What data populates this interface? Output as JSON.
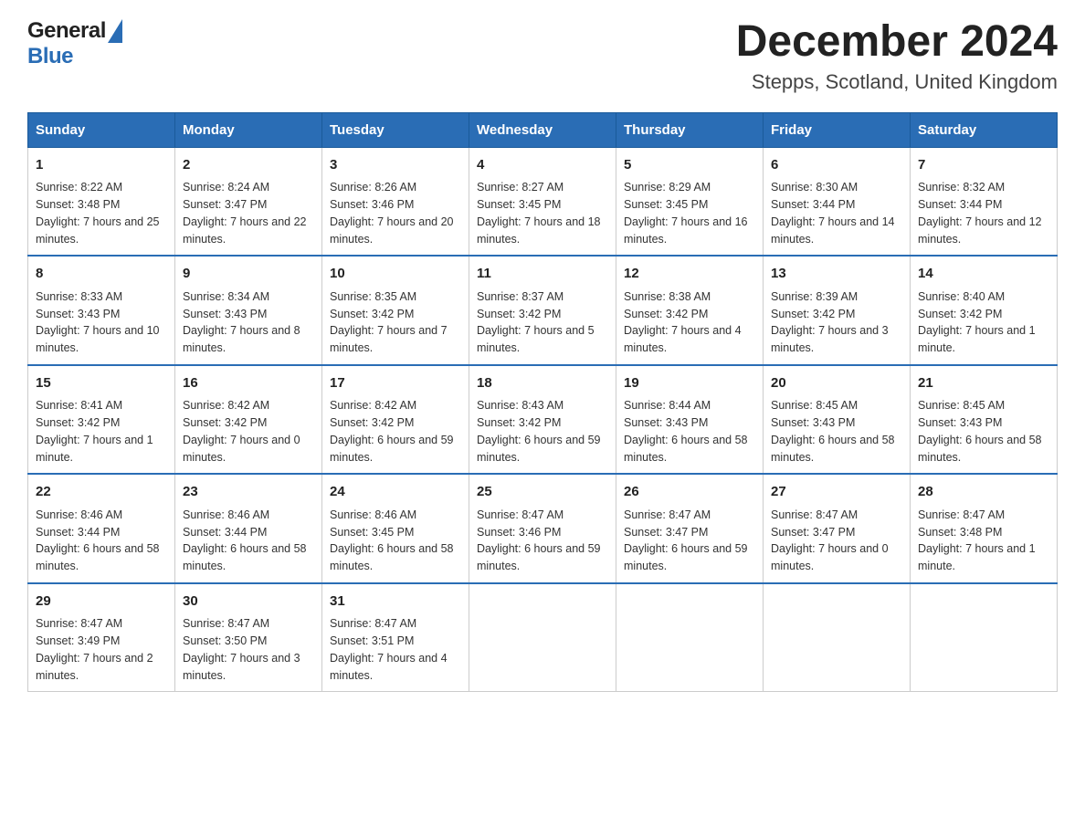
{
  "header": {
    "title": "December 2024",
    "subtitle": "Stepps, Scotland, United Kingdom",
    "logo_general": "General",
    "logo_blue": "Blue"
  },
  "calendar": {
    "days_of_week": [
      "Sunday",
      "Monday",
      "Tuesday",
      "Wednesday",
      "Thursday",
      "Friday",
      "Saturday"
    ],
    "weeks": [
      [
        {
          "day": "1",
          "sunrise": "8:22 AM",
          "sunset": "3:48 PM",
          "daylight": "7 hours and 25 minutes."
        },
        {
          "day": "2",
          "sunrise": "8:24 AM",
          "sunset": "3:47 PM",
          "daylight": "7 hours and 22 minutes."
        },
        {
          "day": "3",
          "sunrise": "8:26 AM",
          "sunset": "3:46 PM",
          "daylight": "7 hours and 20 minutes."
        },
        {
          "day": "4",
          "sunrise": "8:27 AM",
          "sunset": "3:45 PM",
          "daylight": "7 hours and 18 minutes."
        },
        {
          "day": "5",
          "sunrise": "8:29 AM",
          "sunset": "3:45 PM",
          "daylight": "7 hours and 16 minutes."
        },
        {
          "day": "6",
          "sunrise": "8:30 AM",
          "sunset": "3:44 PM",
          "daylight": "7 hours and 14 minutes."
        },
        {
          "day": "7",
          "sunrise": "8:32 AM",
          "sunset": "3:44 PM",
          "daylight": "7 hours and 12 minutes."
        }
      ],
      [
        {
          "day": "8",
          "sunrise": "8:33 AM",
          "sunset": "3:43 PM",
          "daylight": "7 hours and 10 minutes."
        },
        {
          "day": "9",
          "sunrise": "8:34 AM",
          "sunset": "3:43 PM",
          "daylight": "7 hours and 8 minutes."
        },
        {
          "day": "10",
          "sunrise": "8:35 AM",
          "sunset": "3:42 PM",
          "daylight": "7 hours and 7 minutes."
        },
        {
          "day": "11",
          "sunrise": "8:37 AM",
          "sunset": "3:42 PM",
          "daylight": "7 hours and 5 minutes."
        },
        {
          "day": "12",
          "sunrise": "8:38 AM",
          "sunset": "3:42 PM",
          "daylight": "7 hours and 4 minutes."
        },
        {
          "day": "13",
          "sunrise": "8:39 AM",
          "sunset": "3:42 PM",
          "daylight": "7 hours and 3 minutes."
        },
        {
          "day": "14",
          "sunrise": "8:40 AM",
          "sunset": "3:42 PM",
          "daylight": "7 hours and 1 minute."
        }
      ],
      [
        {
          "day": "15",
          "sunrise": "8:41 AM",
          "sunset": "3:42 PM",
          "daylight": "7 hours and 1 minute."
        },
        {
          "day": "16",
          "sunrise": "8:42 AM",
          "sunset": "3:42 PM",
          "daylight": "7 hours and 0 minutes."
        },
        {
          "day": "17",
          "sunrise": "8:42 AM",
          "sunset": "3:42 PM",
          "daylight": "6 hours and 59 minutes."
        },
        {
          "day": "18",
          "sunrise": "8:43 AM",
          "sunset": "3:42 PM",
          "daylight": "6 hours and 59 minutes."
        },
        {
          "day": "19",
          "sunrise": "8:44 AM",
          "sunset": "3:43 PM",
          "daylight": "6 hours and 58 minutes."
        },
        {
          "day": "20",
          "sunrise": "8:45 AM",
          "sunset": "3:43 PM",
          "daylight": "6 hours and 58 minutes."
        },
        {
          "day": "21",
          "sunrise": "8:45 AM",
          "sunset": "3:43 PM",
          "daylight": "6 hours and 58 minutes."
        }
      ],
      [
        {
          "day": "22",
          "sunrise": "8:46 AM",
          "sunset": "3:44 PM",
          "daylight": "6 hours and 58 minutes."
        },
        {
          "day": "23",
          "sunrise": "8:46 AM",
          "sunset": "3:44 PM",
          "daylight": "6 hours and 58 minutes."
        },
        {
          "day": "24",
          "sunrise": "8:46 AM",
          "sunset": "3:45 PM",
          "daylight": "6 hours and 58 minutes."
        },
        {
          "day": "25",
          "sunrise": "8:47 AM",
          "sunset": "3:46 PM",
          "daylight": "6 hours and 59 minutes."
        },
        {
          "day": "26",
          "sunrise": "8:47 AM",
          "sunset": "3:47 PM",
          "daylight": "6 hours and 59 minutes."
        },
        {
          "day": "27",
          "sunrise": "8:47 AM",
          "sunset": "3:47 PM",
          "daylight": "7 hours and 0 minutes."
        },
        {
          "day": "28",
          "sunrise": "8:47 AM",
          "sunset": "3:48 PM",
          "daylight": "7 hours and 1 minute."
        }
      ],
      [
        {
          "day": "29",
          "sunrise": "8:47 AM",
          "sunset": "3:49 PM",
          "daylight": "7 hours and 2 minutes."
        },
        {
          "day": "30",
          "sunrise": "8:47 AM",
          "sunset": "3:50 PM",
          "daylight": "7 hours and 3 minutes."
        },
        {
          "day": "31",
          "sunrise": "8:47 AM",
          "sunset": "3:51 PM",
          "daylight": "7 hours and 4 minutes."
        },
        null,
        null,
        null,
        null
      ]
    ]
  }
}
